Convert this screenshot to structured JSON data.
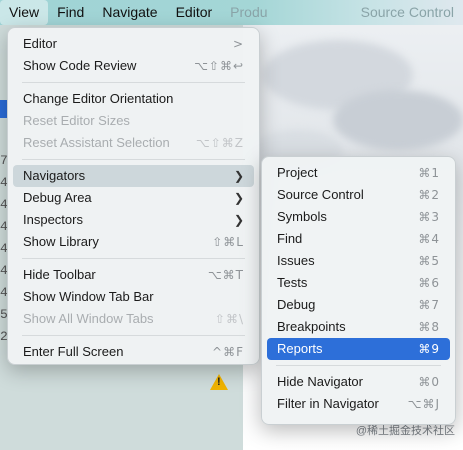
{
  "menubar": {
    "items": [
      "View",
      "Find",
      "Navigate",
      "Editor",
      "Produ",
      "Source Control"
    ]
  },
  "view_menu": {
    "editor": {
      "label": "Editor",
      "shortcut": ">"
    },
    "show_code_review": {
      "label": "Show Code Review",
      "shortcut": "⌥⇧⌘↩"
    },
    "change_orientation": {
      "label": "Change Editor Orientation"
    },
    "reset_editor_sizes": {
      "label": "Reset Editor Sizes"
    },
    "reset_assistant": {
      "label": "Reset Assistant Selection",
      "shortcut": "⌥⇧⌘Z"
    },
    "navigators": {
      "label": "Navigators"
    },
    "debug_area": {
      "label": "Debug Area"
    },
    "inspectors": {
      "label": "Inspectors"
    },
    "show_library": {
      "label": "Show Library",
      "shortcut": "⇧⌘L"
    },
    "hide_toolbar": {
      "label": "Hide Toolbar",
      "shortcut": "⌥⌘T"
    },
    "show_window_tab_bar": {
      "label": "Show Window Tab Bar"
    },
    "show_all_window_tabs": {
      "label": "Show All Window Tabs",
      "shortcut": "⇧⌘\\"
    },
    "enter_full_screen": {
      "label": "Enter Full Screen",
      "shortcut": "^⌘F"
    }
  },
  "navigators_menu": {
    "project": {
      "label": "Project",
      "shortcut": "⌘1"
    },
    "source_control": {
      "label": "Source Control",
      "shortcut": "⌘2"
    },
    "symbols": {
      "label": "Symbols",
      "shortcut": "⌘3"
    },
    "find": {
      "label": "Find",
      "shortcut": "⌘4"
    },
    "issues": {
      "label": "Issues",
      "shortcut": "⌘5"
    },
    "tests": {
      "label": "Tests",
      "shortcut": "⌘6"
    },
    "debug": {
      "label": "Debug",
      "shortcut": "⌘7"
    },
    "breakpoints": {
      "label": "Breakpoints",
      "shortcut": "⌘8"
    },
    "reports": {
      "label": "Reports",
      "shortcut": "⌘9"
    },
    "hide_navigator": {
      "label": "Hide Navigator",
      "shortcut": "⌘0"
    },
    "filter_in_navigator": {
      "label": "Filter in Navigator",
      "shortcut": "⌥⌘J"
    }
  },
  "gutter": {
    "digits": [
      "7",
      "4",
      "4",
      "4",
      "4",
      "4",
      "4",
      "5",
      "2"
    ]
  },
  "watermark": "@稀土掘金技术社区",
  "colors": {
    "selection": "#2d6fd9",
    "menubar": "#a4d6d6",
    "warning": "#f0b300"
  }
}
